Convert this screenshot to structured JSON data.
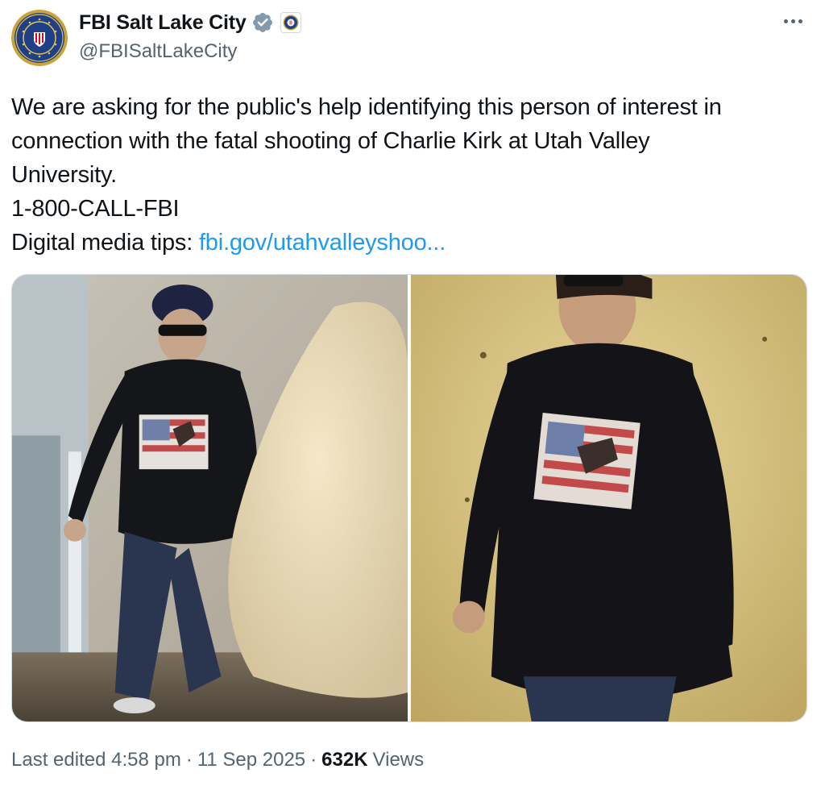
{
  "account": {
    "display_name": "FBI Salt Lake City",
    "handle": "@FBISaltLakeCity",
    "avatar_icon": "fbi-seal-icon",
    "verified_icon": "verified-badge-icon",
    "affiliation_icon": "fbi-affiliate-badge-icon",
    "verified_color": "#829aab"
  },
  "menu": {
    "more_icon": "more-options-icon"
  },
  "tweet": {
    "lines": [
      "We are asking for the public's help identifying this person of interest in",
      "connection with the fatal shooting of Charlie Kirk at Utah Valley",
      "University.",
      "1-800-CALL-FBI"
    ],
    "tips_label": "Digital media tips: ",
    "tips_link": "fbi.gov/utahvalleyshoo...",
    "link_color": "#1d9bf0"
  },
  "media": {
    "photos": [
      {
        "name": "surveillance-photo-stairs"
      },
      {
        "name": "surveillance-photo-closeup"
      }
    ]
  },
  "meta": {
    "edited_label": "Last edited 4:58 pm",
    "separator": "·",
    "date": "11 Sep 2025",
    "views_count": "632K",
    "views_label": "Views"
  }
}
